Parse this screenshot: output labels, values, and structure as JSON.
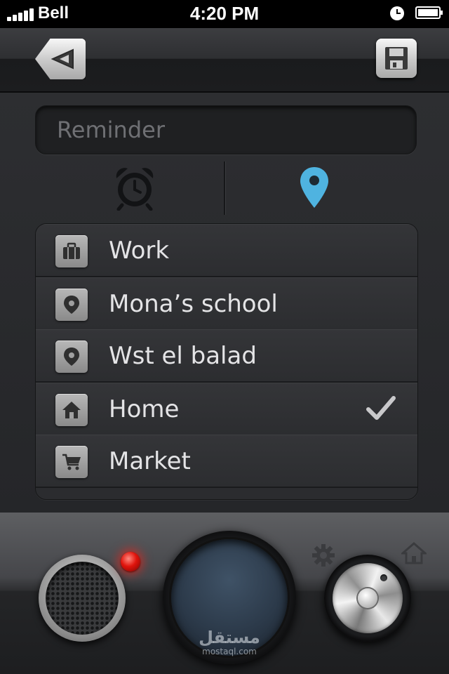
{
  "status_bar": {
    "carrier": "Bell",
    "time": "4:20 PM",
    "icons": [
      "signal-icon",
      "clock-icon",
      "battery-icon"
    ]
  },
  "navbar": {
    "back_icon": "back-arrow-icon",
    "save_icon": "floppy-disk-icon"
  },
  "reminder": {
    "placeholder": "Reminder",
    "value": ""
  },
  "segments": [
    {
      "icon": "alarm-clock-icon",
      "selected": false
    },
    {
      "icon": "location-pin-icon",
      "selected": true
    }
  ],
  "locations": [
    {
      "label": "Work",
      "icon": "briefcase-icon",
      "selected": false
    },
    {
      "label": "Mona’s school",
      "icon": "location-pin-icon",
      "selected": false
    },
    {
      "label": "Wst el balad",
      "icon": "location-pin-icon",
      "selected": false
    },
    {
      "label": "Home",
      "icon": "home-icon",
      "selected": true
    },
    {
      "label": "Market",
      "icon": "shopping-cart-icon",
      "selected": false
    }
  ],
  "panel": {
    "icons": [
      "speaker-icon",
      "record-led",
      "gear-icon",
      "home-icon",
      "knob"
    ]
  },
  "watermark": {
    "arabic": "مستقل",
    "latin": "mostaql.com"
  },
  "colors": {
    "accent_pin": "#4fb3e0",
    "record_led": "#e0140c",
    "background": "#2a2b2d"
  }
}
